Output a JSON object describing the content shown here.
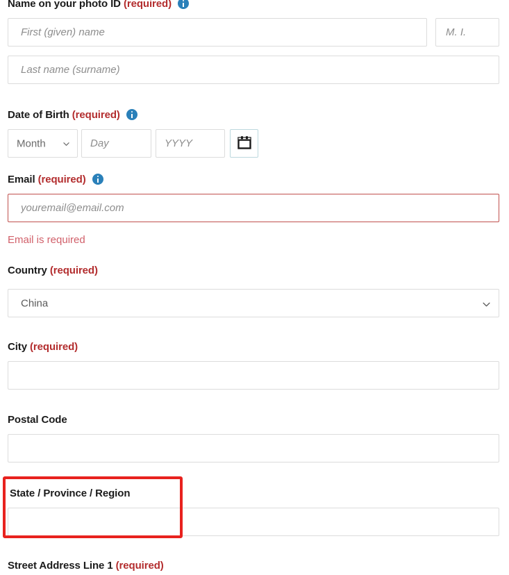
{
  "form": {
    "fields": [
      {
        "key": "name_on_id",
        "label": "Name on your photo ID",
        "required_text": "(required)",
        "has_info_icon": true,
        "info_icon_name": "info-icon",
        "inputs": [
          {
            "key": "first_name",
            "placeholder": "First (given) name",
            "value": ""
          },
          {
            "key": "middle_initial",
            "placeholder": "M. I.",
            "value": ""
          },
          {
            "key": "last_name",
            "placeholder": "Last name (surname)",
            "value": ""
          }
        ]
      },
      {
        "key": "date_of_birth",
        "label": "Date of Birth",
        "required_text": "(required)",
        "has_info_icon": true,
        "month_value": "Month",
        "day_placeholder": "Day",
        "day_value": "",
        "year_placeholder": "YYYY",
        "year_value": "",
        "calendar_icon_name": "calendar-icon"
      },
      {
        "key": "email",
        "label": "Email",
        "required_text": "(required)",
        "has_info_icon": true,
        "placeholder": "youremail@email.com",
        "value": "",
        "error": "Email is required"
      },
      {
        "key": "country",
        "label": "Country",
        "required_text": "(required)",
        "has_info_icon": false,
        "selected": "China"
      },
      {
        "key": "city",
        "label": "City",
        "required_text": "(required)",
        "has_info_icon": false,
        "value": ""
      },
      {
        "key": "postal_code",
        "label": "Postal Code",
        "required_text": "",
        "has_info_icon": false,
        "value": ""
      },
      {
        "key": "state_province_region",
        "label": "State / Province / Region",
        "required_text": "",
        "has_info_icon": false,
        "value": "",
        "highlighted": true
      },
      {
        "key": "street_address_1",
        "label": "Street Address Line 1",
        "required_text": "(required)",
        "has_info_icon": false
      }
    ]
  },
  "colors": {
    "required_red": "#b32d2e",
    "error_text": "#d1606a",
    "error_border": "#c0504d",
    "info_blue": "#2a80b9",
    "annotation_red": "#e8221e",
    "input_border": "#dcdcdc",
    "calendar_border": "#bcd8de",
    "text": "#1b1b1b",
    "placeholder": "#8d8d8d"
  }
}
